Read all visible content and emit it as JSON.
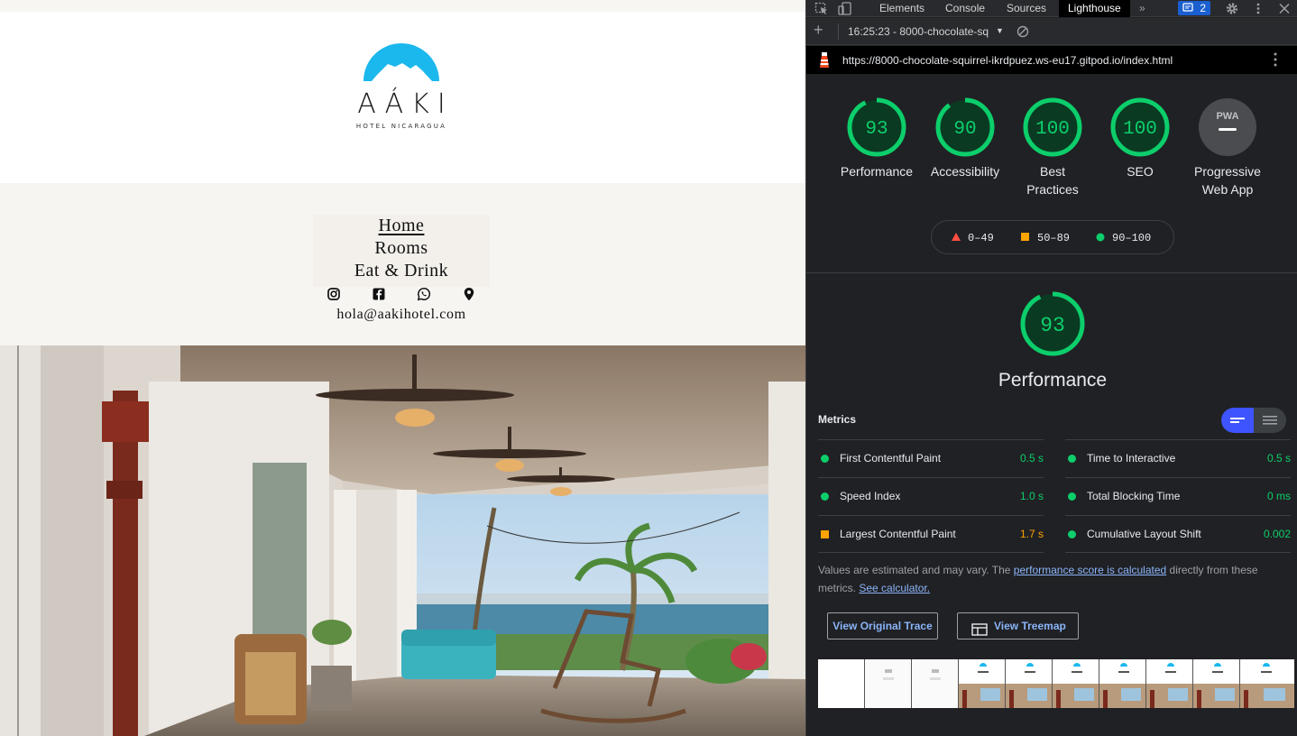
{
  "site": {
    "brand": "AÁKI",
    "tagline": "HOTEL NICARAGUA",
    "nav": [
      "Home",
      "Rooms",
      "Eat & Drink"
    ],
    "social_icons": [
      "instagram-icon",
      "facebook-icon",
      "whatsapp-icon",
      "map-pin-icon"
    ],
    "email": "hola@aakihotel.com",
    "colors": {
      "logo_blue": "#1bb8ee",
      "band_bg": "#f7f5f2"
    }
  },
  "devtools": {
    "tabs": [
      "Elements",
      "Console",
      "Sources",
      "Lighthouse"
    ],
    "active_tab": "Lighthouse",
    "issues_count": "2",
    "report_select": "16:25:23 - 8000-chocolate-sq",
    "url": "https://8000-chocolate-squirrel-ikrdpuez.ws-eu17.gitpod.io/index.html",
    "gauges": [
      {
        "score": "93",
        "label": "Performance",
        "value": 0.93
      },
      {
        "score": "90",
        "label": "Accessibility",
        "value": 0.9
      },
      {
        "score": "100",
        "label": "Best Practices",
        "value": 1.0
      },
      {
        "score": "100",
        "label": "SEO",
        "value": 1.0
      }
    ],
    "pwa": {
      "badge": "PWA",
      "label": "Progressive Web App"
    },
    "legend": {
      "fail": "0–49",
      "average": "50–89",
      "pass": "90–100"
    },
    "perf": {
      "score": "93",
      "title": "Performance"
    },
    "metrics_title": "Metrics",
    "metrics": [
      {
        "name": "First Contentful Paint",
        "value": "0.5 s",
        "status": "pass"
      },
      {
        "name": "Time to Interactive",
        "value": "0.5 s",
        "status": "pass"
      },
      {
        "name": "Speed Index",
        "value": "1.0 s",
        "status": "pass"
      },
      {
        "name": "Total Blocking Time",
        "value": "0 ms",
        "status": "pass"
      },
      {
        "name": "Largest Contentful Paint",
        "value": "1.7 s",
        "status": "average"
      },
      {
        "name": "Cumulative Layout Shift",
        "value": "0.002",
        "status": "pass"
      }
    ],
    "note": {
      "pre": "Values are estimated and may vary. The ",
      "link1": "performance score is calculated",
      "mid": " directly from these metrics. ",
      "link2": "See calculator."
    },
    "buttons": {
      "trace": "View Original Trace",
      "treemap": "View Treemap"
    },
    "colors": {
      "pass": "#0cce6b",
      "average": "#ffa400",
      "fail": "#ff4e42",
      "accent": "#3d54ff"
    }
  }
}
